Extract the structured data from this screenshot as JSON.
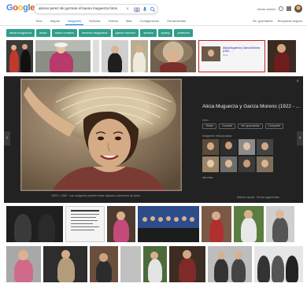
{
  "header": {
    "logo_letters": [
      {
        "ch": "G",
        "color": "#4285f4"
      },
      {
        "ch": "o",
        "color": "#ea4335"
      },
      {
        "ch": "o",
        "color": "#fbbc05"
      },
      {
        "ch": "g",
        "color": "#4285f4"
      },
      {
        "ch": "l",
        "color": "#34a853"
      },
      {
        "ch": "e",
        "color": "#ea4335"
      }
    ],
    "search_value": "alonso perez de guzman el bueno muguerza fotos",
    "clear_icon": "close-icon",
    "camera_icon": "camera-icon",
    "mic_icon": "mic-icon",
    "search_icon": "search-icon",
    "safesearch_label": "",
    "right_links": [
      "Iniciar sesión"
    ],
    "settings_icon": "gear-icon",
    "apps_icon": "apps-grid-icon"
  },
  "tabs": [
    {
      "label": "Todo",
      "active": false
    },
    {
      "label": "Mapas",
      "active": false
    },
    {
      "label": "Imágenes",
      "active": true
    },
    {
      "label": "Noticias",
      "active": false
    },
    {
      "label": "Vídeos",
      "active": false
    },
    {
      "label": "Más",
      "active": false
    },
    {
      "label": "Configuración",
      "active": false
    },
    {
      "label": "Herramientas",
      "active": false
    }
  ],
  "tools_right": [
    "Ver guardadas",
    "Búsqueda segura"
  ],
  "chips": [
    {
      "label": "alicia muguerza",
      "color": "#2f9f8a"
    },
    {
      "label": "dulce",
      "color": "#2f9f8a"
    },
    {
      "label": "dulce nombre",
      "color": "#2f9f8a"
    },
    {
      "label": "sexenio muguerza",
      "color": "#2f9f8a"
    },
    {
      "label": "garcía moreno",
      "color": "#2f9f8a"
    },
    {
      "label": "señora",
      "color": "#2f9f8a"
    },
    {
      "label": "spring",
      "color": "#2f9f8a"
    },
    {
      "label": "pinterest",
      "color": "#2f9f8a"
    }
  ],
  "preview": {
    "title": "Alicia Muguerza y García Moreno (1922 - ...",
    "source": "Geni",
    "actions": [
      "Visitar",
      "Guardar",
      "Ver guardadas",
      "Compartir"
    ],
    "related_label": "Imágenes relacionadas",
    "more_label": "Ver más",
    "caption": "1920 × 1080 · Las imágenes pueden estar sujetas a derechos de autor.",
    "footer": "Obtener ayuda · Enviar sugerencias",
    "prev_label": "‹",
    "next_label": "›",
    "close_label": "×"
  },
  "colors": {
    "accent": "#1a73e8",
    "chip": "#2f9f8a",
    "panel_bg": "#222222",
    "selected_outline": "#c5221f"
  }
}
